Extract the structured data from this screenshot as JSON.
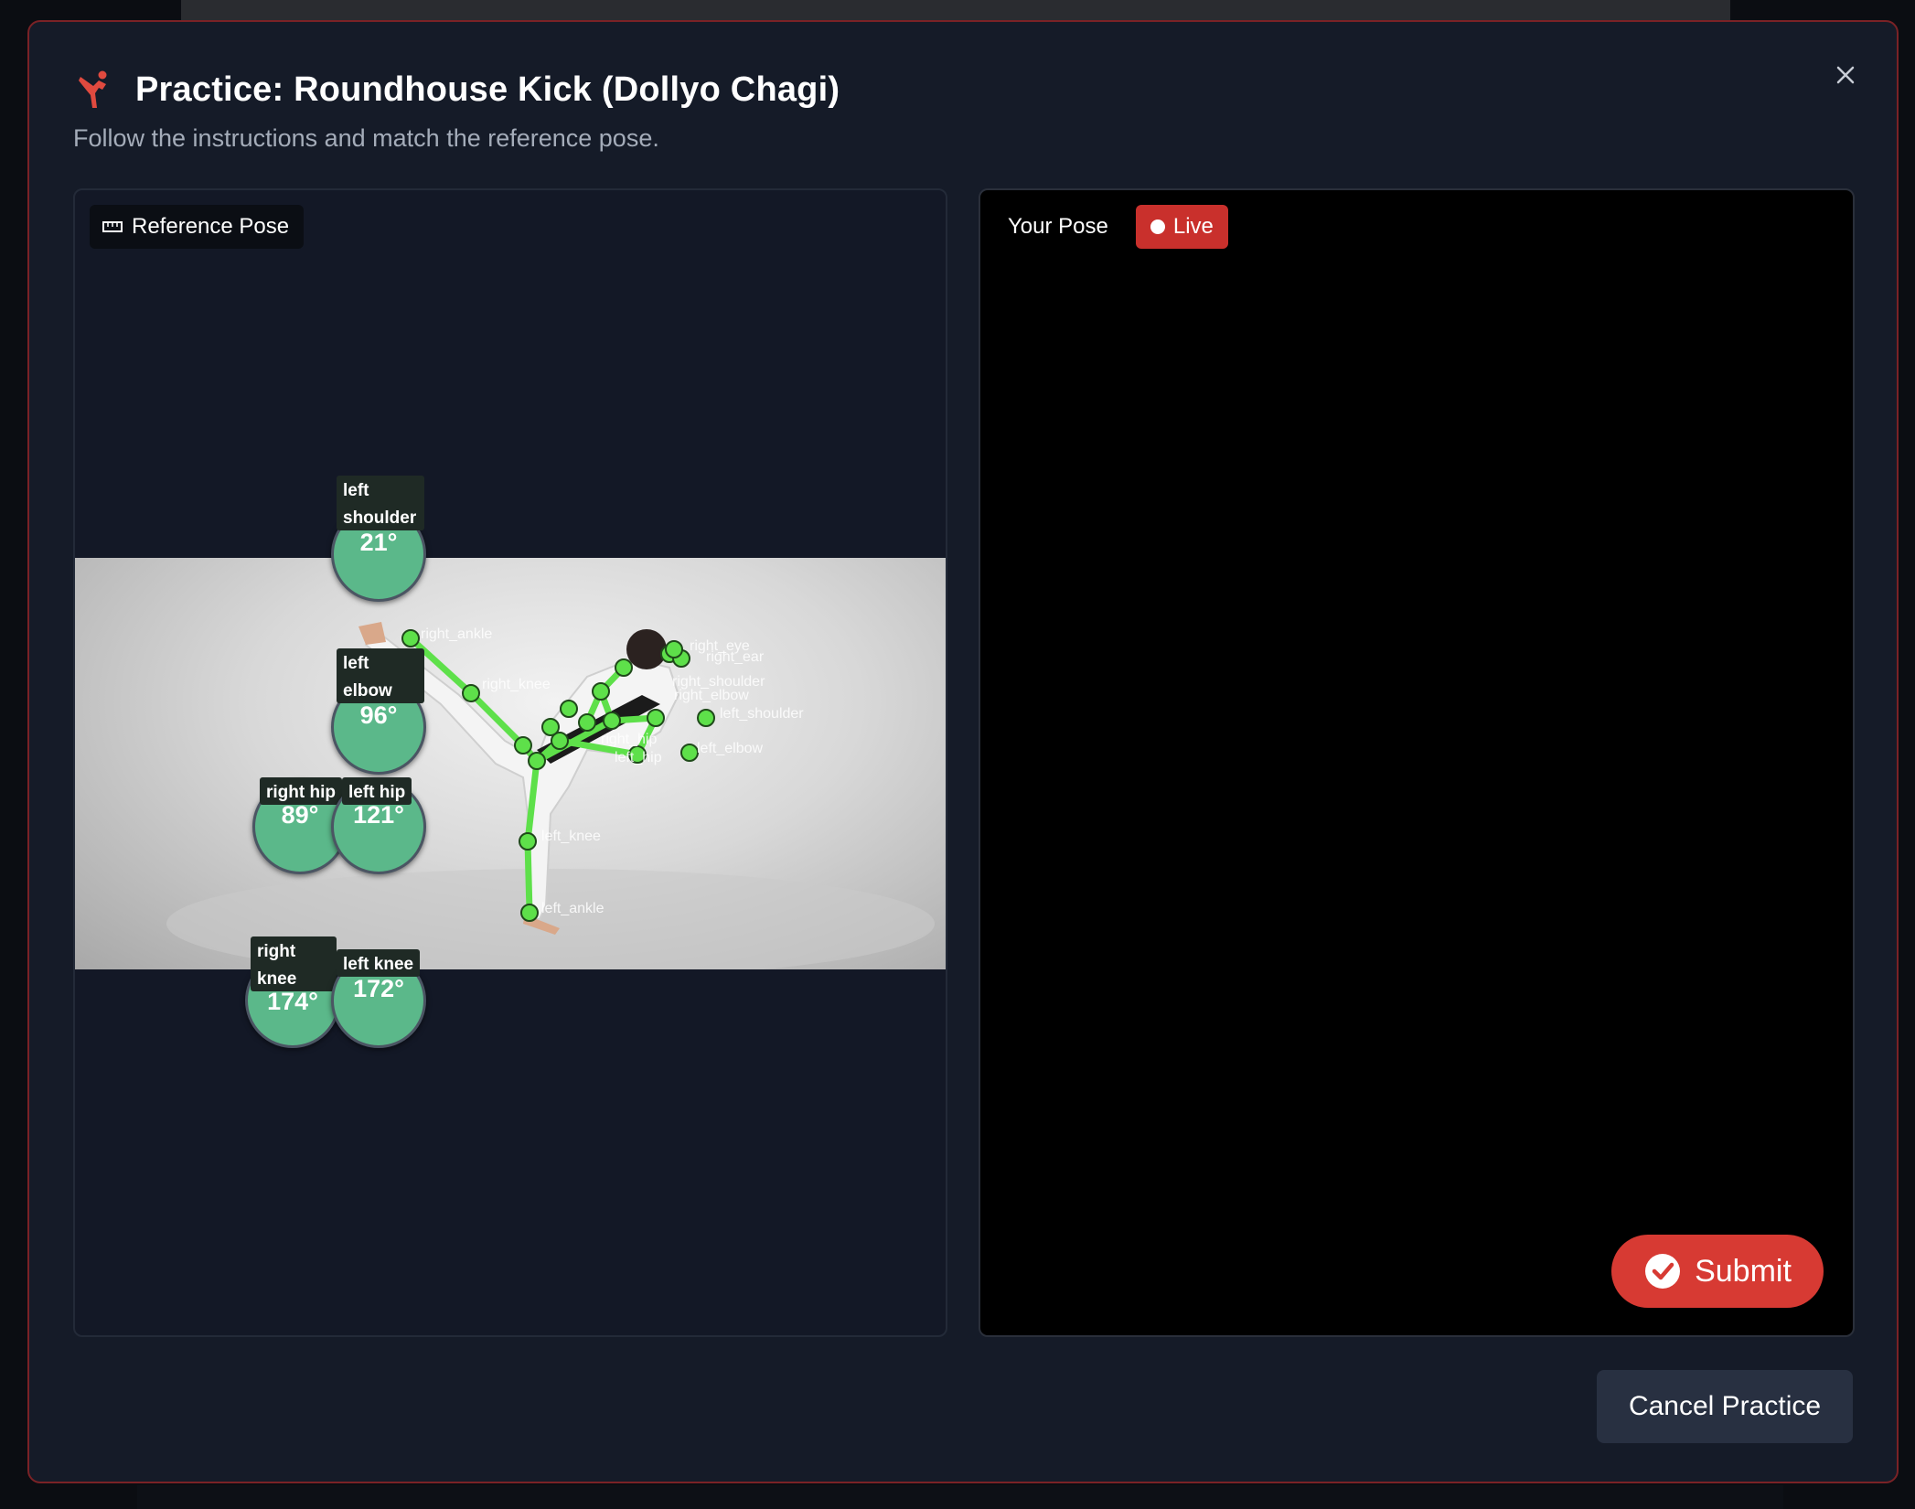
{
  "modal": {
    "title": "Practice: Roundhouse Kick (Dollyo Chagi)",
    "subtitle": "Follow the instructions and match the reference pose.",
    "accent_color": "#e04a3f"
  },
  "reference": {
    "label": "Reference Pose",
    "keypoint_labels": [
      "right_ankle",
      "right_knee",
      "right_eye",
      "right_ear",
      "right_shoulder",
      "right_elbow",
      "left_shoulder",
      "left_elbow",
      "right_hip",
      "left_hip",
      "left_knee",
      "left_ankle"
    ],
    "angles": [
      {
        "joint_line1": "left",
        "joint_line2": "shoulder",
        "value": "21°"
      },
      {
        "joint_line1": "left",
        "joint_line2": "elbow",
        "value": "96°"
      },
      {
        "joint_line1": "right hip",
        "joint_line2": "",
        "value": "89°"
      },
      {
        "joint_line1": "left hip",
        "joint_line2": "",
        "value": "121°"
      },
      {
        "joint_line1": "right",
        "joint_line2": "knee",
        "value": "174°"
      },
      {
        "joint_line1": "left knee",
        "joint_line2": "",
        "value": "172°"
      }
    ],
    "skeleton_color": "#5ee04a"
  },
  "live": {
    "label": "Your Pose",
    "status": "Live",
    "status_color": "#c9302c",
    "submit_label": "Submit"
  },
  "footer": {
    "cancel_label": "Cancel Practice"
  }
}
